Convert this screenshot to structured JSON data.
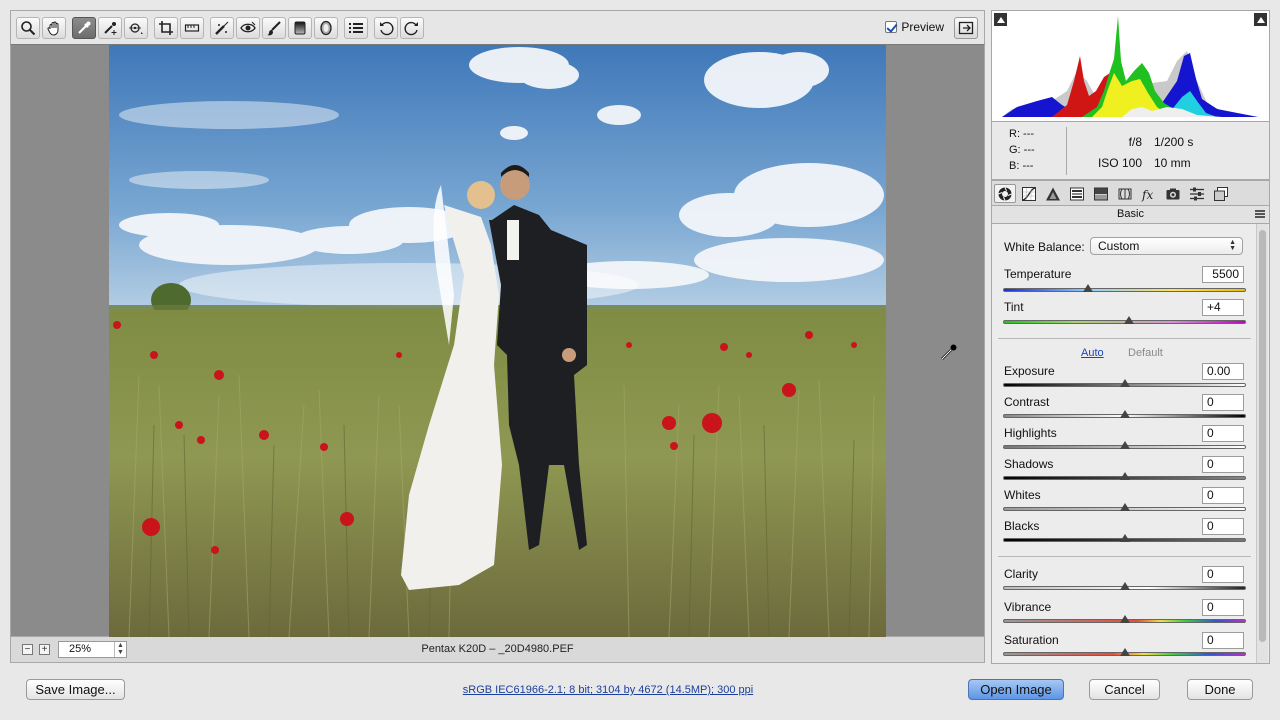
{
  "toolbar": {
    "tools": [
      {
        "name": "zoom-tool",
        "icon": "magnifier-icon"
      },
      {
        "name": "hand-tool",
        "icon": "hand-icon"
      },
      {
        "name": "white-balance-tool",
        "icon": "eyedropper-icon",
        "active": true
      },
      {
        "name": "color-sampler-tool",
        "icon": "color-sampler-icon"
      },
      {
        "name": "targeted-adjustment-tool",
        "icon": "target-adjust-icon"
      },
      {
        "name": "crop-tool",
        "icon": "crop-icon"
      },
      {
        "name": "straighten-tool",
        "icon": "straighten-icon"
      },
      {
        "name": "spot-removal-tool",
        "icon": "spot-removal-icon"
      },
      {
        "name": "red-eye-tool",
        "icon": "red-eye-icon"
      },
      {
        "name": "adjustment-brush-tool",
        "icon": "brush-icon"
      },
      {
        "name": "graduated-filter-tool",
        "icon": "graduated-filter-icon"
      },
      {
        "name": "radial-filter-tool",
        "icon": "radial-filter-icon"
      },
      {
        "name": "preferences-button",
        "icon": "list-icon"
      },
      {
        "name": "rotate-left-button",
        "icon": "rotate-ccw-icon"
      },
      {
        "name": "rotate-right-button",
        "icon": "rotate-cw-icon"
      }
    ],
    "preview_label": "Preview",
    "preview_checked": true
  },
  "statusbar": {
    "zoom": "25%",
    "file_label": "Pentax K20D  –  _20D4980.PEF"
  },
  "info": {
    "r": "R:  ---",
    "g": "G:  ---",
    "b": "B:  ---",
    "aperture": "f/8",
    "shutter": "1/200 s",
    "iso": "ISO 100",
    "focal": "10 mm"
  },
  "panel": {
    "title": "Basic",
    "white_balance_label": "White Balance:",
    "white_balance_value": "Custom",
    "auto_label": "Auto",
    "default_label": "Default",
    "sliders": {
      "temperature": {
        "label": "Temperature",
        "value": "5500",
        "level": 0.35
      },
      "tint": {
        "label": "Tint",
        "value": "+4",
        "level": 0.52
      },
      "exposure": {
        "label": "Exposure",
        "value": "0.00",
        "level": 0.5
      },
      "contrast": {
        "label": "Contrast",
        "value": "0",
        "level": 0.5
      },
      "highlights": {
        "label": "Highlights",
        "value": "0",
        "level": 0.5
      },
      "shadows": {
        "label": "Shadows",
        "value": "0",
        "level": 0.5
      },
      "whites": {
        "label": "Whites",
        "value": "0",
        "level": 0.5
      },
      "blacks": {
        "label": "Blacks",
        "value": "0",
        "level": 0.5
      },
      "clarity": {
        "label": "Clarity",
        "value": "0",
        "level": 0.5
      },
      "vibrance": {
        "label": "Vibrance",
        "value": "0",
        "level": 0.5
      },
      "saturation": {
        "label": "Saturation",
        "value": "0",
        "level": 0.5
      }
    }
  },
  "bottom": {
    "save_label": "Save Image...",
    "workflow_link": "sRGB IEC61966-2.1; 8 bit; 3104 by 4672 (14.5MP); 300 ppi",
    "open_label": "Open Image",
    "cancel_label": "Cancel",
    "done_label": "Done"
  },
  "colors": {
    "accent": "#5d95e6",
    "link": "#1c3f9c"
  }
}
